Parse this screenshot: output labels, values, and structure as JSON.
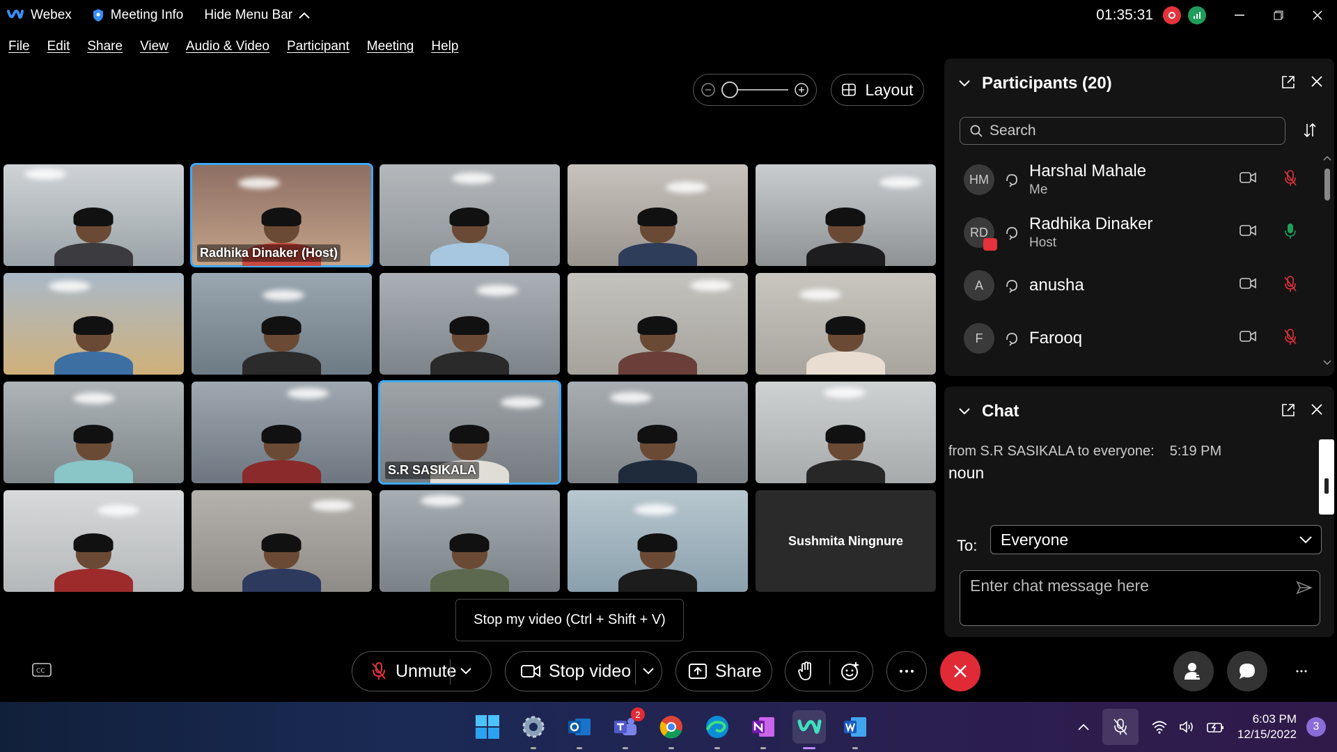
{
  "titlebar": {
    "app_name": "Webex",
    "meeting_info": "Meeting Info",
    "hide_menu": "Hide Menu Bar",
    "timer": "01:35:31"
  },
  "menubar": [
    "File",
    "Edit",
    "Share",
    "View",
    "Audio & Video",
    "Participant",
    "Meeting",
    "Help"
  ],
  "controls": {
    "layout_label": "Layout"
  },
  "videos": [
    {
      "name": "",
      "active": false
    },
    {
      "name": "Radhika Dinaker (Host)",
      "active": true
    },
    {
      "name": "",
      "active": false
    },
    {
      "name": "",
      "active": false
    },
    {
      "name": "",
      "active": false
    },
    {
      "name": "",
      "active": false
    },
    {
      "name": "",
      "active": false
    },
    {
      "name": "",
      "active": false
    },
    {
      "name": "",
      "active": false
    },
    {
      "name": "",
      "active": false
    },
    {
      "name": "",
      "active": false
    },
    {
      "name": "",
      "active": false
    },
    {
      "name": "S.R SASIKALA",
      "active": true
    },
    {
      "name": "",
      "active": false
    },
    {
      "name": "",
      "active": false
    },
    {
      "name": "",
      "active": false
    },
    {
      "name": "",
      "active": false
    },
    {
      "name": "",
      "active": false
    },
    {
      "name": "",
      "active": false
    },
    {
      "name": "Sushmita Ningnure",
      "active": false,
      "video_off": true
    }
  ],
  "tooltip": "Stop my video (Ctrl + Shift + V)",
  "toolbar": {
    "unmute": "Unmute",
    "stop_video": "Stop video",
    "share": "Share"
  },
  "participants": {
    "title": "Participants (20)",
    "search_placeholder": "Search",
    "list": [
      {
        "initials": "HM",
        "name": "Harshal Mahale",
        "role": "Me",
        "mic": "muted"
      },
      {
        "initials": "RD",
        "name": "Radhika Dinaker",
        "role": "Host",
        "mic": "active"
      },
      {
        "initials": "A",
        "name": "anusha",
        "role": "",
        "mic": "muted"
      },
      {
        "initials": "F",
        "name": "Farooq",
        "role": "",
        "mic": "muted"
      }
    ]
  },
  "chat": {
    "title": "Chat",
    "message_meta": "from S.R SASIKALA to everyone:",
    "message_time": "5:19 PM",
    "message_text": "noun",
    "to_label": "To:",
    "to_value": "Everyone",
    "input_placeholder": "Enter chat message here"
  },
  "taskbar": {
    "teams_badge": "2",
    "time": "6:03 PM",
    "date": "12/15/2022",
    "notifications": "3"
  },
  "colors": {
    "end_call": "#e02b36",
    "active_outline": "#3ea8f5",
    "muted_mic": "#e5323b",
    "active_mic": "#1e9e5a"
  }
}
